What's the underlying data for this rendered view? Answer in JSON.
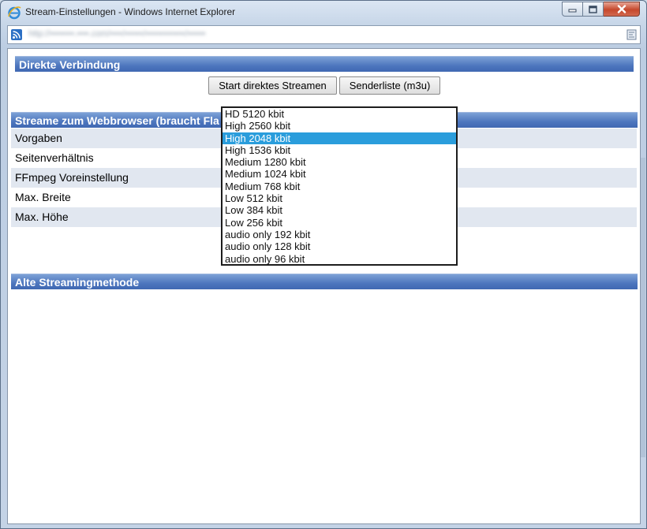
{
  "window": {
    "title": "Stream-Einstellungen - Windows Internet Explorer",
    "url": "http://••••••••.••••.com/••••/••••••/•••••••••••••/••••••"
  },
  "sections": {
    "direct": "Direkte Verbindung",
    "webbrowser": "Streame zum Webbrowser (braucht Fla",
    "old": "Alte Streamingmethode"
  },
  "buttons": {
    "start_direct": "Start direktes Streamen",
    "station_list": "Senderliste (m3u)"
  },
  "settings_rows": [
    "Vorgaben",
    "Seitenverhältnis",
    "FFmpeg Voreinstellung",
    "Max. Breite",
    "Max. Höhe"
  ],
  "bitrate_options": [
    "HD 5120 kbit",
    "High 2560 kbit",
    "High 2048 kbit",
    "High 1536 kbit",
    "Medium 1280 kbit",
    "Medium 1024 kbit",
    "Medium 768 kbit",
    "Low 512 kbit",
    "Low 384 kbit",
    "Low 256 kbit",
    "audio only 192 kbit",
    "audio only 128 kbit",
    "audio only 96 kbit"
  ],
  "selected_option": "High 2048 kbit",
  "colors": {
    "header_blue": "#4d76be",
    "selection": "#2a9ddc",
    "row_shade": "#e1e7f0"
  },
  "icons": [
    "ie-icon",
    "rss-icon",
    "compat-view-icon",
    "minimize-icon",
    "maximize-icon",
    "close-icon"
  ]
}
